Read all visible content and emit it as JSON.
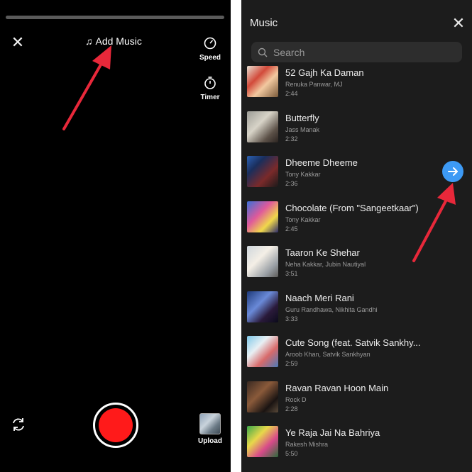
{
  "camera": {
    "add_music_label": "Add Music",
    "speed_label": "Speed",
    "timer_label": "Timer",
    "upload_label": "Upload",
    "record_color": "#ff1a1a"
  },
  "music": {
    "title": "Music",
    "search_placeholder": "Search",
    "tracks": [
      {
        "title": "52 Gajh Ka Daman",
        "artist": "Renuka Panwar, MJ",
        "duration": "2:44"
      },
      {
        "title": "Butterfly",
        "artist": "Jass Manak",
        "duration": "2:32"
      },
      {
        "title": "Dheeme Dheeme",
        "artist": "Tony Kakkar",
        "duration": "2:36"
      },
      {
        "title": "Chocolate (From \"Sangeetkaar\")",
        "artist": "Tony Kakkar",
        "duration": "2:45"
      },
      {
        "title": "Taaron Ke Shehar",
        "artist": "Neha Kakkar, Jubin Nautiyal",
        "duration": "3:51"
      },
      {
        "title": "Naach Meri Rani",
        "artist": "Guru Randhawa, Nikhita Gandhi",
        "duration": "3:33"
      },
      {
        "title": "Cute Song (feat. Satvik Sankhy...",
        "artist": "Aroob Khan, Satvik Sankhyan",
        "duration": "2:59"
      },
      {
        "title": "Ravan Ravan Hoon Main",
        "artist": "Rock D",
        "duration": "2:28"
      },
      {
        "title": "Ye Raja Jai Na Bahriya",
        "artist": "Rakesh Mishra",
        "duration": "5:50"
      }
    ],
    "accent_color": "#3d9af5"
  },
  "annotation_color": "#e8283a"
}
